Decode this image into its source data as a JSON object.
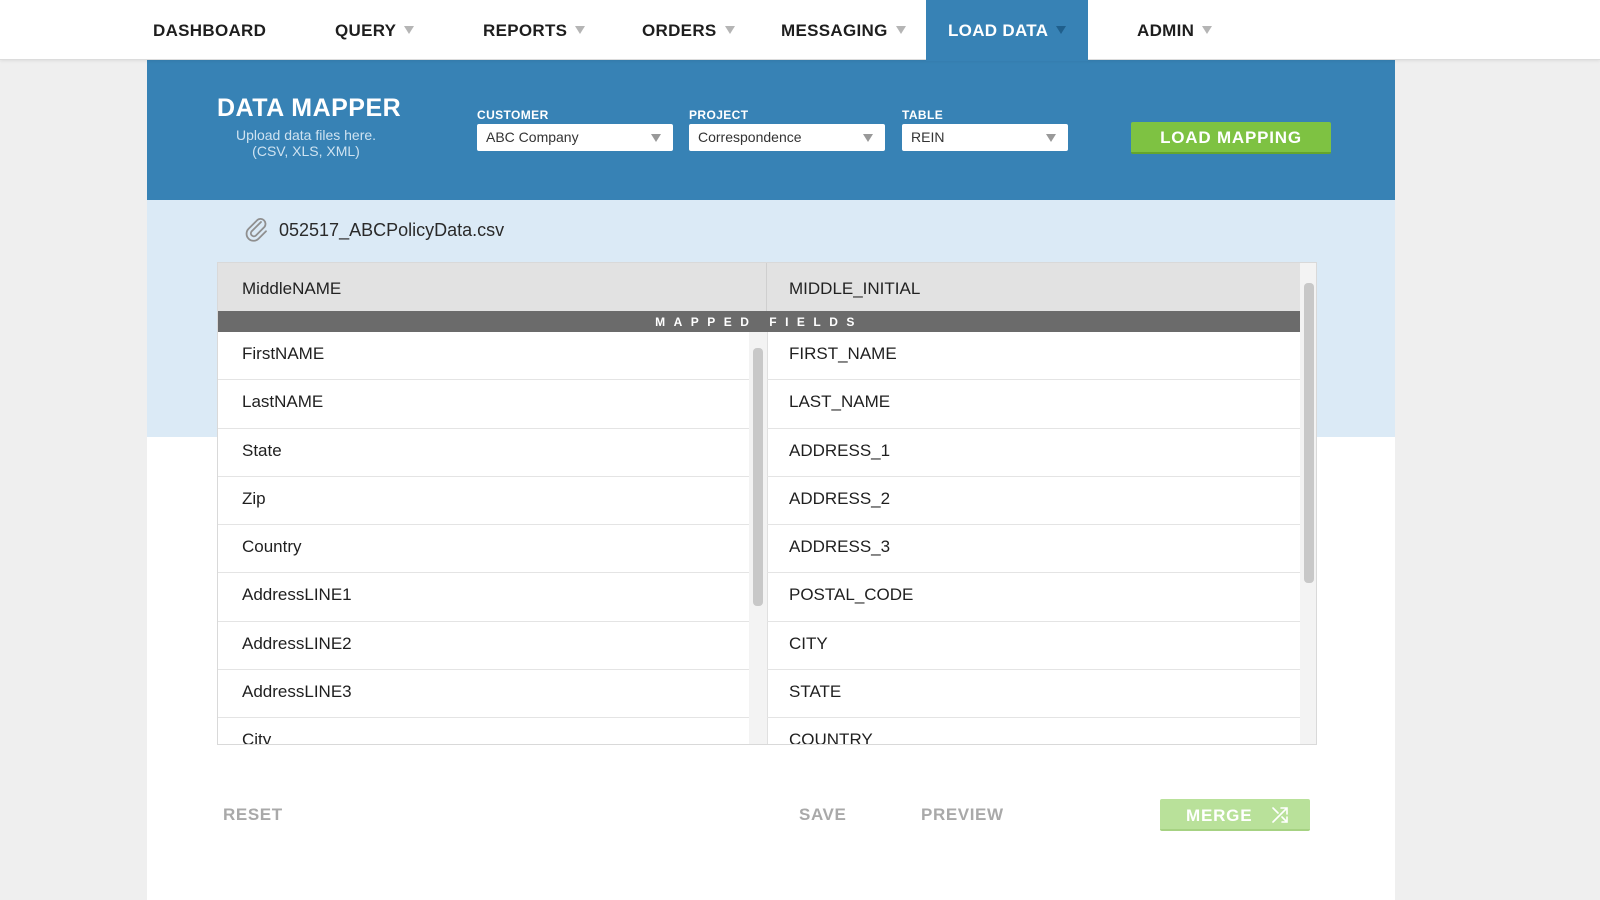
{
  "nav": {
    "items": [
      {
        "label": "DASHBOARD",
        "has_caret": false
      },
      {
        "label": "QUERY",
        "has_caret": true
      },
      {
        "label": "REPORTS",
        "has_caret": true
      },
      {
        "label": "ORDERS",
        "has_caret": true
      },
      {
        "label": "MESSAGING",
        "has_caret": true
      },
      {
        "label": "LOAD DATA",
        "has_caret": true,
        "active": true
      },
      {
        "label": "ADMIN",
        "has_caret": true
      }
    ]
  },
  "mapper": {
    "title": "DATA MAPPER",
    "subtitle_line1": "Upload data files here.",
    "subtitle_line2": "(CSV, XLS, XML)"
  },
  "filters": {
    "customer": {
      "label": "CUSTOMER",
      "value": "ABC Company"
    },
    "project": {
      "label": "PROJECT",
      "value": "Correspondence"
    },
    "table": {
      "label": "TABLE",
      "value": "REIN"
    }
  },
  "load_mapping_label": "LOAD MAPPING",
  "file": {
    "name": "052517_ABCPolicyData.csv",
    "icon": "paperclip-icon"
  },
  "table": {
    "header_left": "MiddleNAME",
    "header_right": "MIDDLE_INITIAL",
    "mapped_label": "MAPPED FIELDS",
    "left_fields": [
      "FirstNAME",
      "LastNAME",
      "State",
      "Zip",
      "Country",
      "AddressLINE1",
      "AddressLINE2",
      "AddressLINE3",
      "City"
    ],
    "right_fields": [
      "FIRST_NAME",
      "LAST_NAME",
      "ADDRESS_1",
      "ADDRESS_2",
      "ADDRESS_3",
      "POSTAL_CODE",
      "CITY",
      "STATE",
      "COUNTRY"
    ]
  },
  "footer": {
    "reset": "RESET",
    "save": "SAVE",
    "preview": "PREVIEW",
    "merge": "MERGE",
    "merge_icon": "shuffle-icon"
  },
  "colors": {
    "primary_blue": "#3782b5",
    "light_blue": "#dbeaf6",
    "green": "#7ec242",
    "green_disabled": "#b9e19a"
  }
}
